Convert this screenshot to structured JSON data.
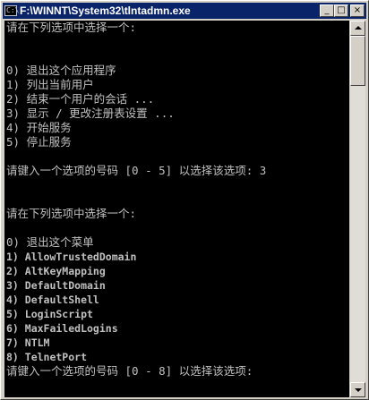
{
  "window": {
    "title": "F:\\WINNT\\System32\\tlntadmn.exe",
    "icon": "console-icon",
    "buttons": {
      "minimize": "_",
      "maximize": "□",
      "close": "×"
    }
  },
  "console": {
    "lines": [
      "请在下列选项中选择一个:",
      "",
      "",
      "0) 退出这个应用程序",
      "1) 列出当前用户",
      "2) 结束一个用户的会话 ...",
      "3) 显示 / 更改注册表设置 ...",
      "4) 开始服务",
      "5) 停止服务",
      "",
      "请键入一个选项的号码 [0 - 5] 以选择该选项: 3",
      "",
      "",
      "请在下列选项中选择一个:",
      "",
      "0) 退出这个菜单",
      "1) AllowTrustedDomain",
      "2) AltKeyMapping",
      "3) DefaultDomain",
      "4) DefaultShell",
      "5) LoginScript",
      "6) MaxFailedLogins",
      "7) NTLM",
      "8) TelnetPort",
      "请键入一个选项的号码 [0 - 8] 以选择该选项:"
    ]
  }
}
